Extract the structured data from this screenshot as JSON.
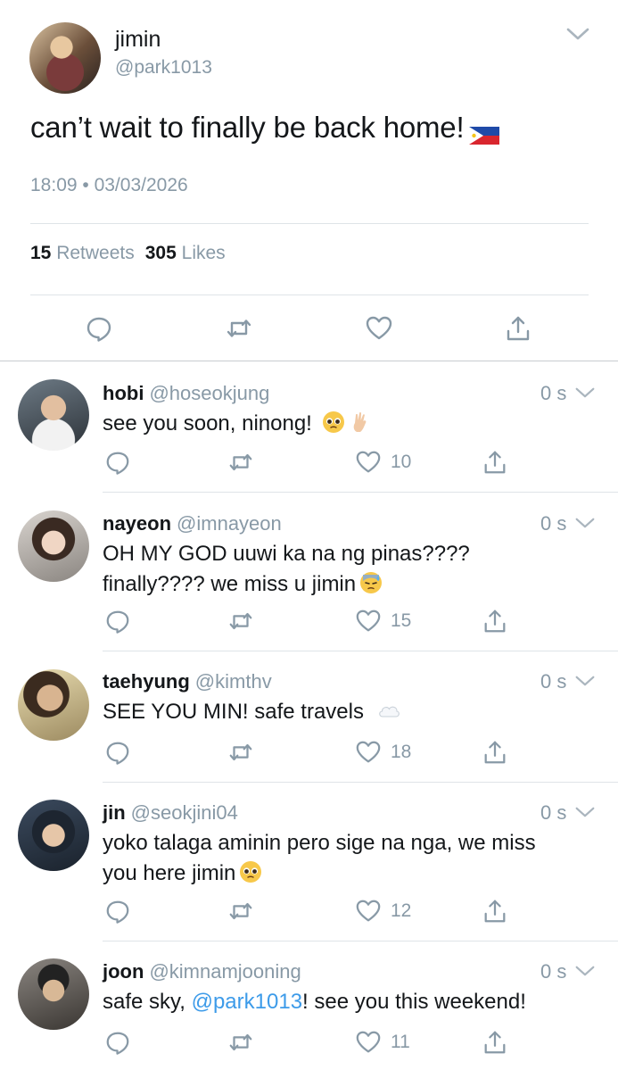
{
  "main_tweet": {
    "display_name": "jimin",
    "handle": "@park1013",
    "text": "can’t wait to finally be back home!",
    "timestamp": "18:09 • 03/03/2026",
    "retweets_count": "15",
    "retweets_label": "Retweets",
    "likes_count": "305",
    "likes_label": "Likes",
    "flag_icon": "philippines-flag-icon"
  },
  "colors": {
    "text": "#14171a",
    "muted": "#8899a6",
    "divider": "#dfe4e8",
    "link": "#3d9be9"
  },
  "replies": [
    {
      "name": "hobi",
      "handle": "@hoseokjung",
      "time": "0 s",
      "text": "see you soon, ninong!",
      "emojis": [
        "pleading-face-emoji",
        "ok-hand-emoji"
      ],
      "likes": "10"
    },
    {
      "name": "nayeon",
      "handle": "@imnayeon",
      "time": "0 s",
      "text_line1": "OH MY GOD uuwi ka na ng pinas????",
      "text_line2": "finally???? we miss u jimin",
      "emojis": [
        "downcast-sweat-face-emoji"
      ],
      "likes": "15"
    },
    {
      "name": "taehyung",
      "handle": "@kimthv",
      "time": "0 s",
      "text": "SEE YOU MIN! safe travels",
      "emojis": [
        "cloud-emoji"
      ],
      "likes": "18"
    },
    {
      "name": "jin",
      "handle": "@seokjini04",
      "time": "0 s",
      "text_line1": "yoko talaga aminin pero sige na nga, we miss",
      "text_line2": "you here jimin",
      "emojis": [
        "pleading-face-emoji"
      ],
      "likes": "12"
    },
    {
      "name": "joon",
      "handle": "@kimnamjooning",
      "time": "0 s",
      "text_prefix": "safe sky, ",
      "mention": "@park1013",
      "text_suffix": "! see you this weekend!",
      "likes": "11"
    }
  ]
}
